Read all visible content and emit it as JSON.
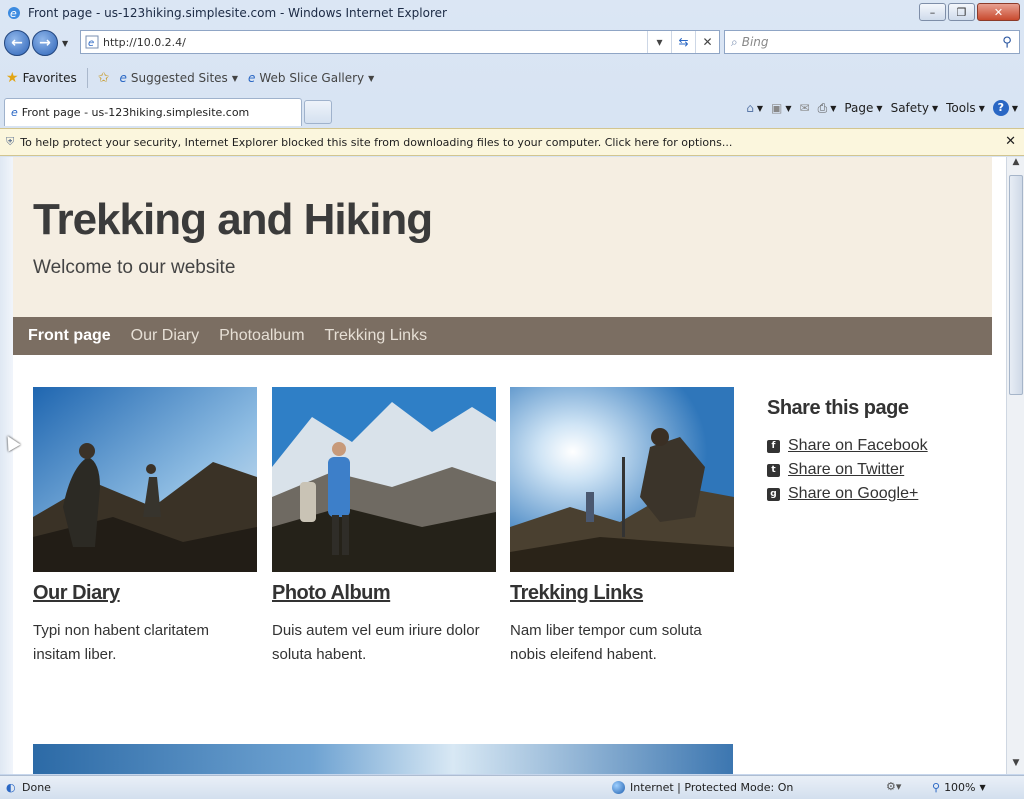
{
  "browser": {
    "window_title": "Front page - us-123hiking.simplesite.com - Windows Internet Explorer",
    "address": "http://10.0.2.4/",
    "search_placeholder": "Bing",
    "favorites": {
      "favorites_label": "Favorites",
      "suggested_sites": "Suggested Sites",
      "web_slice_gallery": "Web Slice Gallery"
    },
    "tab_title": "Front page - us-123hiking.simplesite.com",
    "command_bar": {
      "page": "Page",
      "safety": "Safety",
      "tools": "Tools"
    },
    "info_bar": "To help protect your security, Internet Explorer blocked this site from downloading files to your computer. Click here for options...",
    "status": {
      "done": "Done",
      "zone": "Internet | Protected Mode: On",
      "zoom": "100%"
    }
  },
  "site": {
    "title": "Trekking and Hiking",
    "subtitle": "Welcome to our website",
    "nav": [
      "Front page",
      "Our Diary",
      "Photoalbum",
      "Trekking Links"
    ],
    "cards": [
      {
        "title": "Our Diary",
        "text": "Typi non habent claritatem insitam liber."
      },
      {
        "title": "Photo Album",
        "text": "Duis autem vel eum iriure dolor soluta habent."
      },
      {
        "title": "Trekking Links",
        "text": "Nam liber tempor cum soluta nobis eleifend habent."
      }
    ],
    "share": {
      "heading": "Share this page",
      "links": [
        "Share on Facebook",
        "Share on Twitter",
        "Share on Google+"
      ]
    }
  },
  "colors": {
    "hero_bg": "#f5eee2",
    "nav_bg": "#7b6e62",
    "info_bar_bg": "#fbf6dd"
  }
}
